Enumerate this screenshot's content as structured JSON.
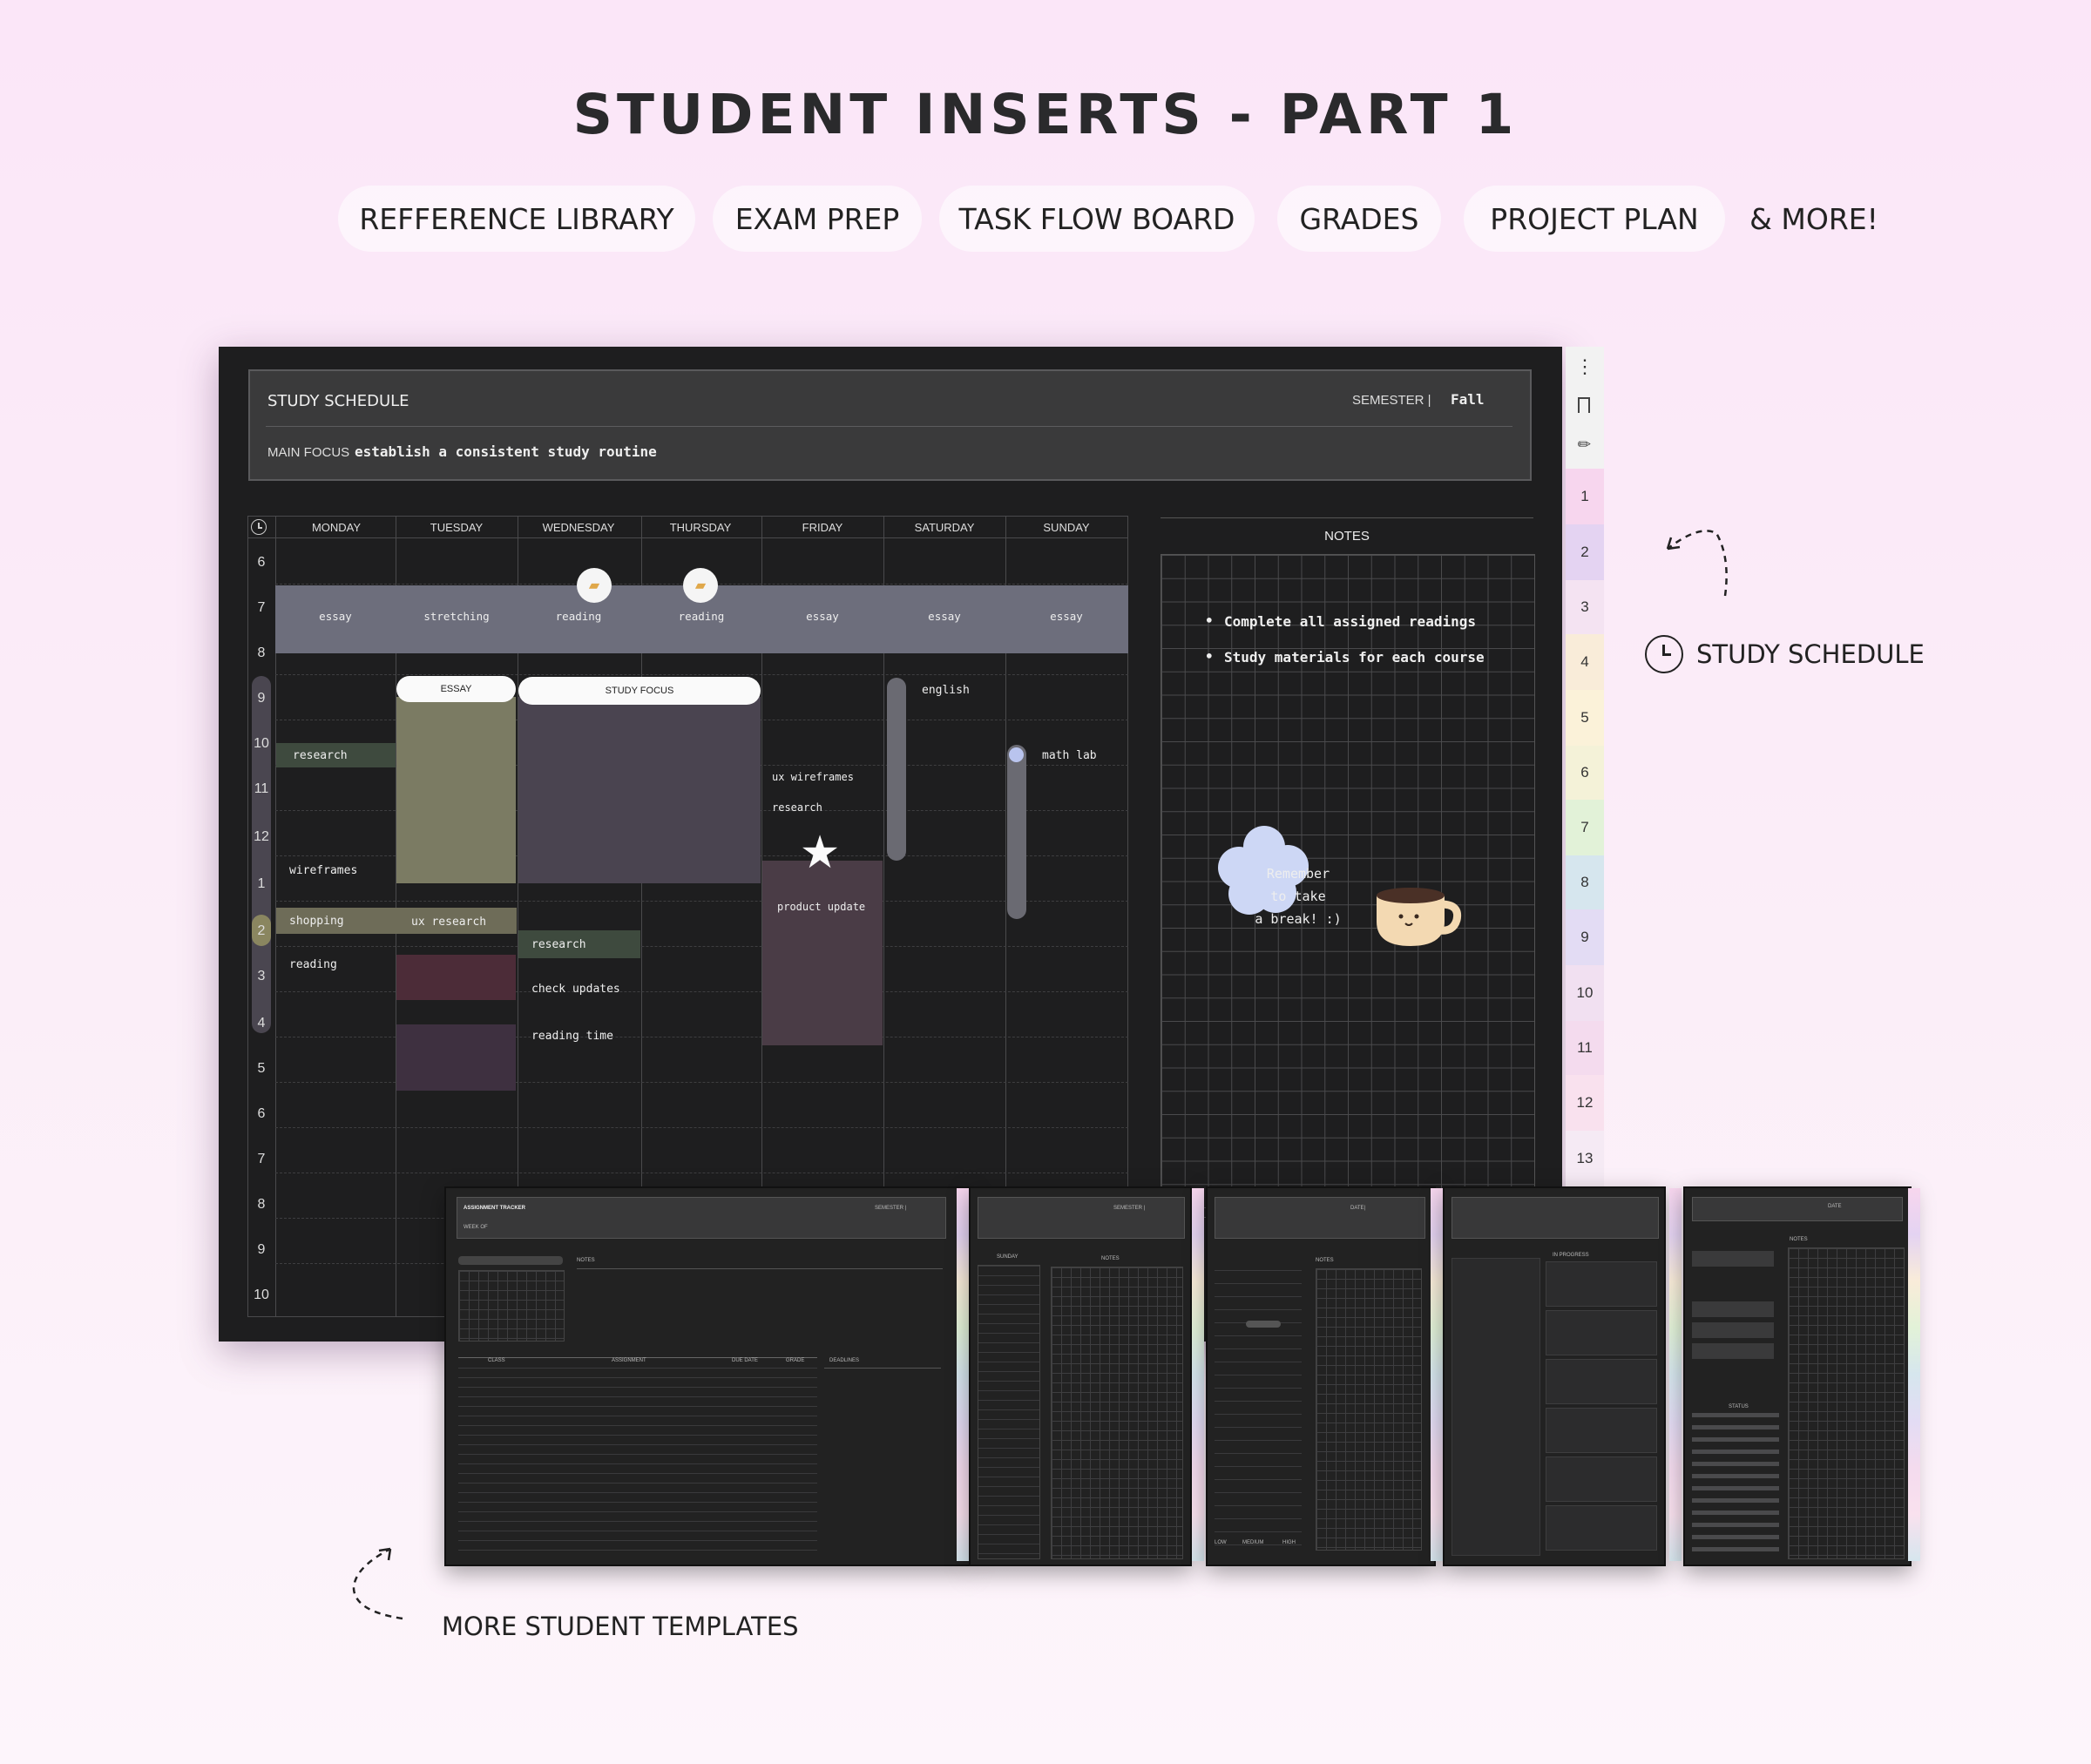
{
  "title": "STUDENT INSERTS - PART 1",
  "pills": [
    "REFFERENCE LIBRARY",
    "EXAM PREP",
    "TASK FLOW BOARD",
    "GRADES",
    "PROJECT PLAN"
  ],
  "more": "& MORE!",
  "side_label": "STUDY SCHEDULE",
  "bottom_label": "MORE STUDENT TEMPLATES",
  "planner": {
    "title": "STUDY SCHEDULE",
    "semester_label": "SEMESTER |",
    "semester_value": "Fall",
    "focus_label": "MAIN FOCUS",
    "focus_value": "establish a consistent study routine",
    "days": [
      "MONDAY",
      "TUESDAY",
      "WEDNESDAY",
      "THURSDAY",
      "FRIDAY",
      "SATURDAY",
      "SUNDAY"
    ],
    "hours": [
      "6",
      "7",
      "8",
      "9",
      "10",
      "11",
      "12",
      "1",
      "2",
      "3",
      "4",
      "5",
      "6",
      "7",
      "8",
      "9",
      "10"
    ],
    "morning": [
      "essay",
      "stretching",
      "reading",
      "reading",
      "essay",
      "essay",
      "essay"
    ],
    "blocks": {
      "essay": "ESSAY",
      "study_focus": "STUDY FOCUS",
      "english": "english",
      "math_lab": "math lab",
      "research1": "research",
      "ux_wireframes": "ux wireframes",
      "research2": "research",
      "wireframes": "wireframes",
      "product_update": "product update",
      "shopping": "shopping",
      "ux_research": "ux research",
      "research3": "research",
      "reading": "reading",
      "check_updates": "check updates",
      "reading_time": "reading time"
    },
    "notes_title": "NOTES",
    "notes": [
      "Complete all assigned readings",
      "Study materials for each course"
    ],
    "reminder": [
      "Remember",
      "to take",
      "a break! :)"
    ],
    "tabs": [
      "1",
      "2",
      "3",
      "4",
      "5",
      "6",
      "7",
      "8",
      "9",
      "10",
      "11",
      "12",
      "13"
    ],
    "tab_colors": [
      "#f7d6ee",
      "#e4d3f2",
      "#f4e3f2",
      "#f9ecd9",
      "#fbf2d9",
      "#f4f2d8",
      "#e2f2d8",
      "#d6e6ee",
      "#e3dcf4",
      "#f1e0f1",
      "#f4dbee",
      "#f9e1ee",
      "#f5eaf4"
    ]
  },
  "thumbs": {
    "assign_title": "ASSIGNMENT TRACKER",
    "semester": "SEMESTER |",
    "week_of": "WEEK OF",
    "notes": "NOTES",
    "cols": [
      "CLASS",
      "ASSIGNMENT",
      "DUE DATE",
      "GRADE"
    ],
    "deadlines": "DEADLINES",
    "sunday": "SUNDAY",
    "date": "DATE|",
    "in_progress": "IN PROGRESS",
    "status": "STATUS",
    "date2": "DATE",
    "priority": [
      "LOW",
      "MEDIUM",
      "HIGH"
    ]
  }
}
